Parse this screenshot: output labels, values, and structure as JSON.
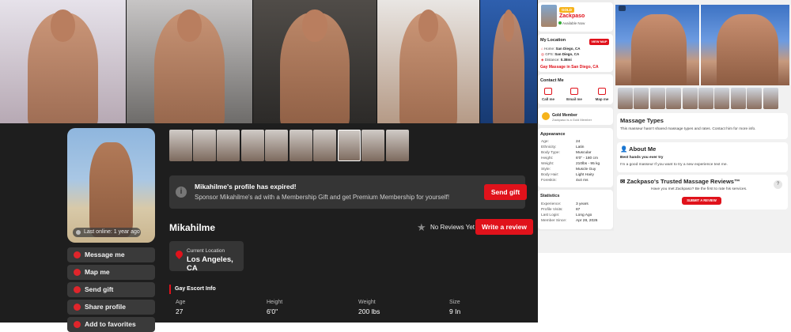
{
  "left_profile": {
    "last_online": "Last online: 1 year ago",
    "sidebar": [
      {
        "label": "Message me",
        "icon": "message-icon"
      },
      {
        "label": "Map me",
        "icon": "map-pin-icon"
      },
      {
        "label": "Send gift",
        "icon": "gift-icon"
      },
      {
        "label": "Share profile",
        "icon": "share-icon"
      },
      {
        "label": "Add to favorites",
        "icon": "heart-icon"
      }
    ],
    "expired": {
      "title": "Mikahilme's profile has expired!",
      "subtitle": "Sponsor Mikahilme's ad with a Membership Gift and get Premium Membership for yourself!",
      "button": "Send gift"
    },
    "name": "Mikahilme",
    "no_reviews": "No Reviews Yet",
    "write_review": "Write a review",
    "location": {
      "label": "Current Location",
      "city": "Los Angeles, CA"
    },
    "escort_info_title": "Gay Escort Info",
    "stats": [
      {
        "label": "Age",
        "value": "27"
      },
      {
        "label": "Height",
        "value": "6'0\""
      },
      {
        "label": "Weight",
        "value": "200 lbs"
      },
      {
        "label": "Size",
        "value": "9 In"
      }
    ]
  },
  "right_profile": {
    "badge": "GOLD",
    "name": "Zackpaso",
    "availability": "Available Now",
    "my_location_title": "My Location",
    "view_map": "VIEW MAP",
    "locations": [
      {
        "label": "Home:",
        "value": "San Diego, CA"
      },
      {
        "label": "GPS:",
        "value": "San Diego, CA"
      },
      {
        "label": "Distance:",
        "value": "0.38mi"
      }
    ],
    "gay_massage_link": "Gay Massage in San Diego, CA",
    "contact_title": "Contact Me",
    "contact": [
      "Call me",
      "Email me",
      "Map me"
    ],
    "gold_member": "Gold Member",
    "gold_sub": "Zackpaso is a Gold Member",
    "appearance_title": "Appearance",
    "appearance": [
      {
        "label": "Age:",
        "value": "24"
      },
      {
        "label": "Ethnicity:",
        "value": "Latin"
      },
      {
        "label": "Body Type:",
        "value": "Muscular"
      },
      {
        "label": "Height:",
        "value": "6'0\" - 180 cm"
      },
      {
        "label": "Weight:",
        "value": "210lbs - 95 kg"
      },
      {
        "label": "Style:",
        "value": "Muscle Guy"
      },
      {
        "label": "Body Hair:",
        "value": "Light Hairy"
      },
      {
        "label": "Foreskin:",
        "value": "4x4 ms"
      }
    ],
    "statistics_title": "Statistics",
    "statistics": [
      {
        "label": "Experience:",
        "value": "3 years"
      },
      {
        "label": "Profile Visits:",
        "value": "87"
      },
      {
        "label": "Last Login:",
        "value": "Long Ago"
      },
      {
        "label": "Member Since:",
        "value": "Apr 28, 2026"
      }
    ],
    "massage_types_title": "Massage Types",
    "massage_types_text": "This masseur hasn't shared massage types and rates. Contact him for more info.",
    "about_title": "About Me",
    "about_headline": "Best hands you ever try",
    "about_text": "I'm a good masseur If you want to try a new experience text me.",
    "reviews_title": "Zackpaso's Trusted Massage Reviews™",
    "reviews_text": "Have you met Zackpaso? Be the first to rate his services.",
    "submit_review": "SUBMIT A REVIEW"
  },
  "colors": {
    "accent": "#e0121b",
    "gold": "#f6b31b",
    "dark_bg": "#252525"
  }
}
